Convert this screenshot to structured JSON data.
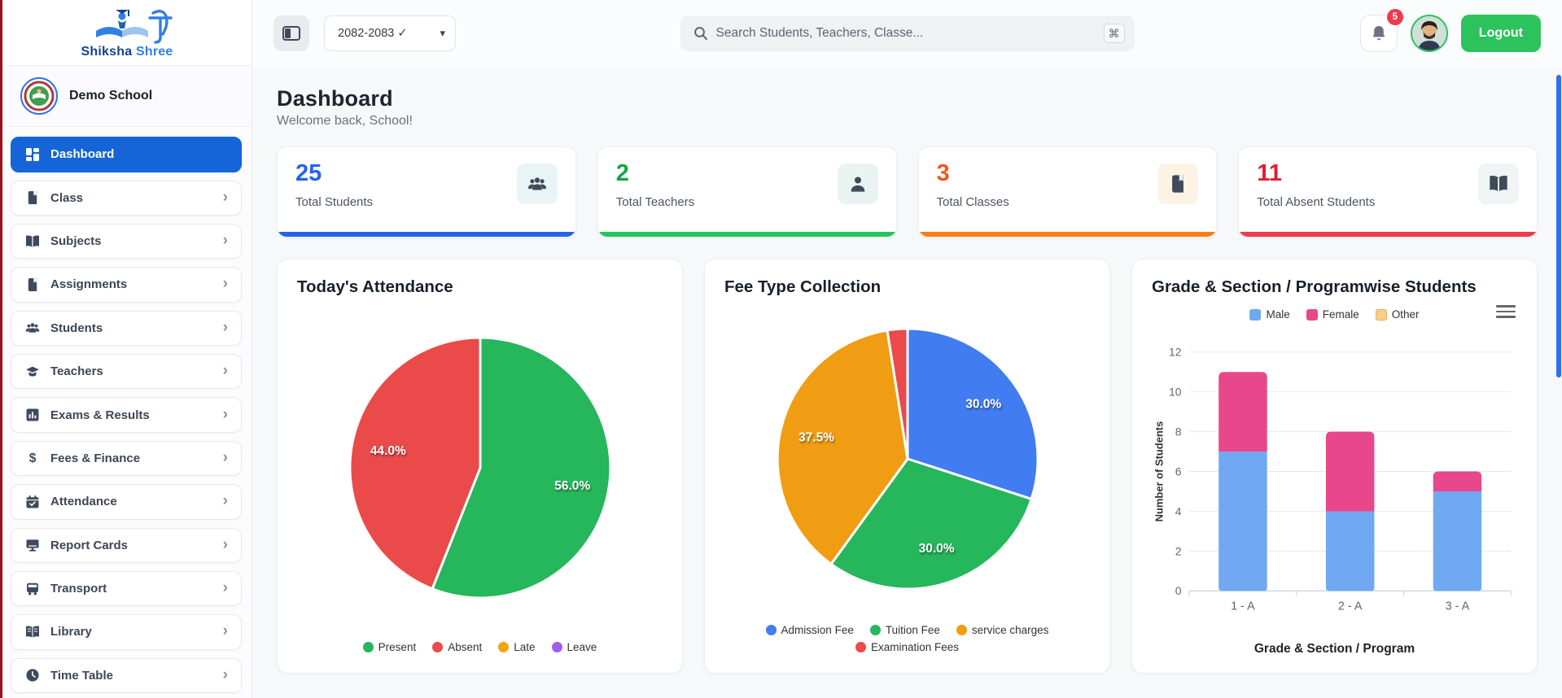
{
  "brand": {
    "name_primary": "Shiksha",
    "name_secondary": "Shree",
    "school_name": "Demo School"
  },
  "header": {
    "session_select": "2082-2083 ✓",
    "search_placeholder": "Search Students, Teachers, Classe...",
    "shortcut_key": "⌘",
    "notification_count": "5",
    "logout_label": "Logout"
  },
  "page": {
    "title": "Dashboard",
    "subtitle": "Welcome back, School!"
  },
  "sidebar": {
    "items": [
      {
        "label": "Dashboard",
        "icon": "dashboard",
        "active": true
      },
      {
        "label": "Class",
        "icon": "book",
        "active": false
      },
      {
        "label": "Subjects",
        "icon": "open-book",
        "active": false
      },
      {
        "label": "Assignments",
        "icon": "book",
        "active": false
      },
      {
        "label": "Students",
        "icon": "people",
        "active": false
      },
      {
        "label": "Teachers",
        "icon": "grad-cap",
        "active": false
      },
      {
        "label": "Exams & Results",
        "icon": "chart",
        "active": false
      },
      {
        "label": "Fees & Finance",
        "icon": "dollar",
        "active": false
      },
      {
        "label": "Attendance",
        "icon": "calendar-check",
        "active": false
      },
      {
        "label": "Report Cards",
        "icon": "monitor",
        "active": false
      },
      {
        "label": "Transport",
        "icon": "bus",
        "active": false
      },
      {
        "label": "Library",
        "icon": "library",
        "active": false
      },
      {
        "label": "Time Table",
        "icon": "clock",
        "active": false
      }
    ]
  },
  "stats": [
    {
      "value": "25",
      "label": "Total Students",
      "value_color": "#2563eb",
      "bar_color": "#2563eb",
      "icon": "people",
      "icon_bg": "#e9f4f7"
    },
    {
      "value": "2",
      "label": "Total Teachers",
      "value_color": "#16a34a",
      "bar_color": "#22c55e",
      "icon": "person",
      "icon_bg": "#e9f4f2"
    },
    {
      "value": "3",
      "label": "Total Classes",
      "value_color": "#f4581c",
      "bar_color": "#fd7e14",
      "icon": "book",
      "icon_bg": "#fdf3e5"
    },
    {
      "value": "11",
      "label": "Total Absent Students",
      "value_color": "#e01e37",
      "bar_color": "#ef3b4e",
      "icon": "open-book",
      "icon_bg": "#f1f4f4"
    }
  ],
  "chart_data": [
    {
      "type": "pie",
      "title": "Today's Attendance",
      "labels": [
        "Present",
        "Absent",
        "Late",
        "Leave"
      ],
      "values": [
        56.0,
        44.0,
        0,
        0
      ],
      "colors": [
        "#26b65c",
        "#ea4a4a",
        "#f2a40f",
        "#a25df2"
      ],
      "value_format": "percent",
      "legend_position": "bottom"
    },
    {
      "type": "pie",
      "title": "Fee Type Collection",
      "labels": [
        "Admission Fee",
        "Tuition Fee",
        "service charges",
        "Examination Fees"
      ],
      "values": [
        30.0,
        30.0,
        37.5,
        2.5
      ],
      "colors": [
        "#417df0",
        "#26b65c",
        "#f09d13",
        "#ea4a4a"
      ],
      "value_format": "percent",
      "legend_position": "bottom",
      "legend_rows": [
        3,
        1
      ]
    },
    {
      "type": "bar",
      "stacked": true,
      "title": "Grade & Section / Programwise Students",
      "categories": [
        "1 - A",
        "2 - A",
        "3 - A"
      ],
      "series": [
        {
          "name": "Male",
          "color": "#70a9f2",
          "values": [
            7,
            4,
            5
          ]
        },
        {
          "name": "Female",
          "color": "#e8488b",
          "values": [
            4,
            4,
            1
          ]
        },
        {
          "name": "Other",
          "color": "#f9d190",
          "values": [
            0,
            0,
            0
          ]
        }
      ],
      "xlabel": "Grade & Section / Program",
      "ylabel": "Number of Students",
      "ylim": [
        0,
        12
      ],
      "yticks": [
        0,
        2,
        4,
        6,
        8,
        10,
        12
      ],
      "grid": true,
      "legend_position": "top"
    }
  ]
}
